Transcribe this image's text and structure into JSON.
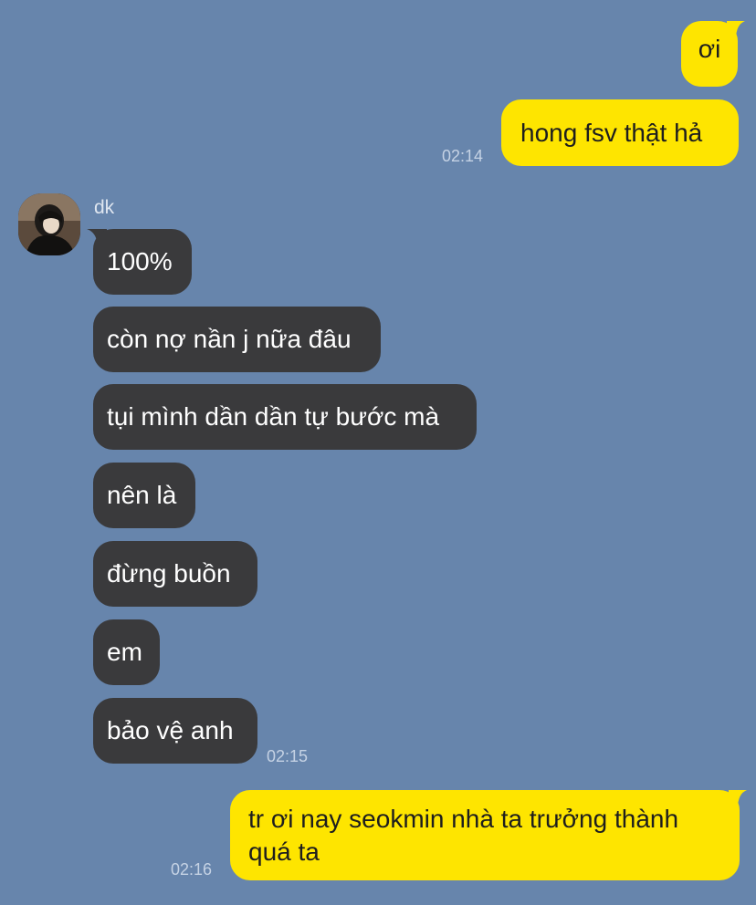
{
  "chat": {
    "contact_name": "dk",
    "messages": [
      {
        "side": "out",
        "text": "ơi"
      },
      {
        "side": "out",
        "text": "hong fsv thật hả",
        "time": "02:14"
      },
      {
        "side": "in",
        "text": "100%"
      },
      {
        "side": "in",
        "text": "còn nợ nần j nữa đâu"
      },
      {
        "side": "in",
        "text": "tụi mình dần dần tự bước mà"
      },
      {
        "side": "in",
        "text": "nên là"
      },
      {
        "side": "in",
        "text": "đừng buồn"
      },
      {
        "side": "in",
        "text": "em"
      },
      {
        "side": "in",
        "text": "bảo vệ anh",
        "time": "02:15"
      },
      {
        "side": "out",
        "text": "tr ơi nay seokmin nhà ta trưởng thành quá ta",
        "time": "02:16"
      }
    ]
  },
  "colors": {
    "background": "#6785ac",
    "outgoing_bubble": "#fee500",
    "incoming_bubble": "#3a3a3c"
  },
  "icons": {
    "avatar": "profile-photo"
  }
}
